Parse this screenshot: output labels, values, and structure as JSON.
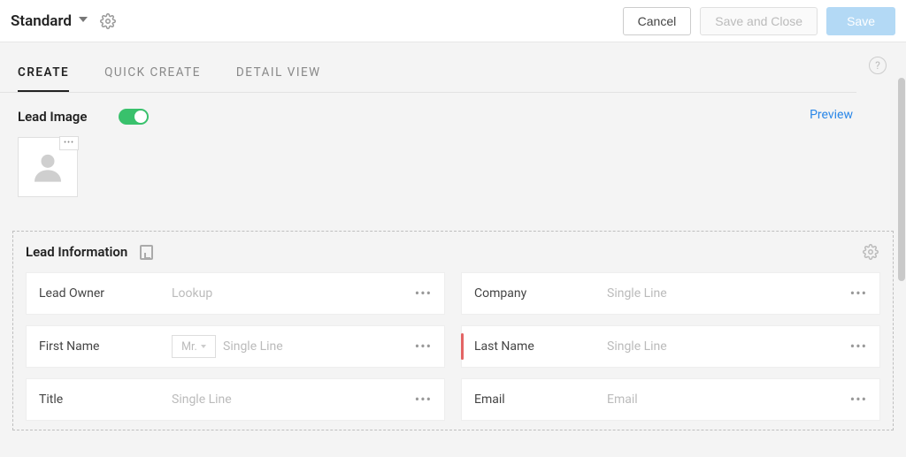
{
  "header": {
    "layoutName": "Standard",
    "buttons": {
      "cancel": "Cancel",
      "saveClose": "Save and Close",
      "save": "Save"
    }
  },
  "tabs": {
    "create": "Create",
    "quickCreate": "Quick Create",
    "detailView": "Detail View",
    "active": "create"
  },
  "previewLabel": "Preview",
  "leadImage": {
    "label": "Lead Image",
    "enabled": true
  },
  "section": {
    "title": "Lead Information",
    "leftFields": [
      {
        "label": "Lead Owner",
        "type": "Lookup",
        "required": false,
        "salutation": null
      },
      {
        "label": "First Name",
        "type": "Single Line",
        "required": false,
        "salutation": "Mr."
      },
      {
        "label": "Title",
        "type": "Single Line",
        "required": false,
        "salutation": null
      }
    ],
    "rightFields": [
      {
        "label": "Company",
        "type": "Single Line",
        "required": false
      },
      {
        "label": "Last Name",
        "type": "Single Line",
        "required": true
      },
      {
        "label": "Email",
        "type": "Email",
        "required": false
      }
    ]
  }
}
